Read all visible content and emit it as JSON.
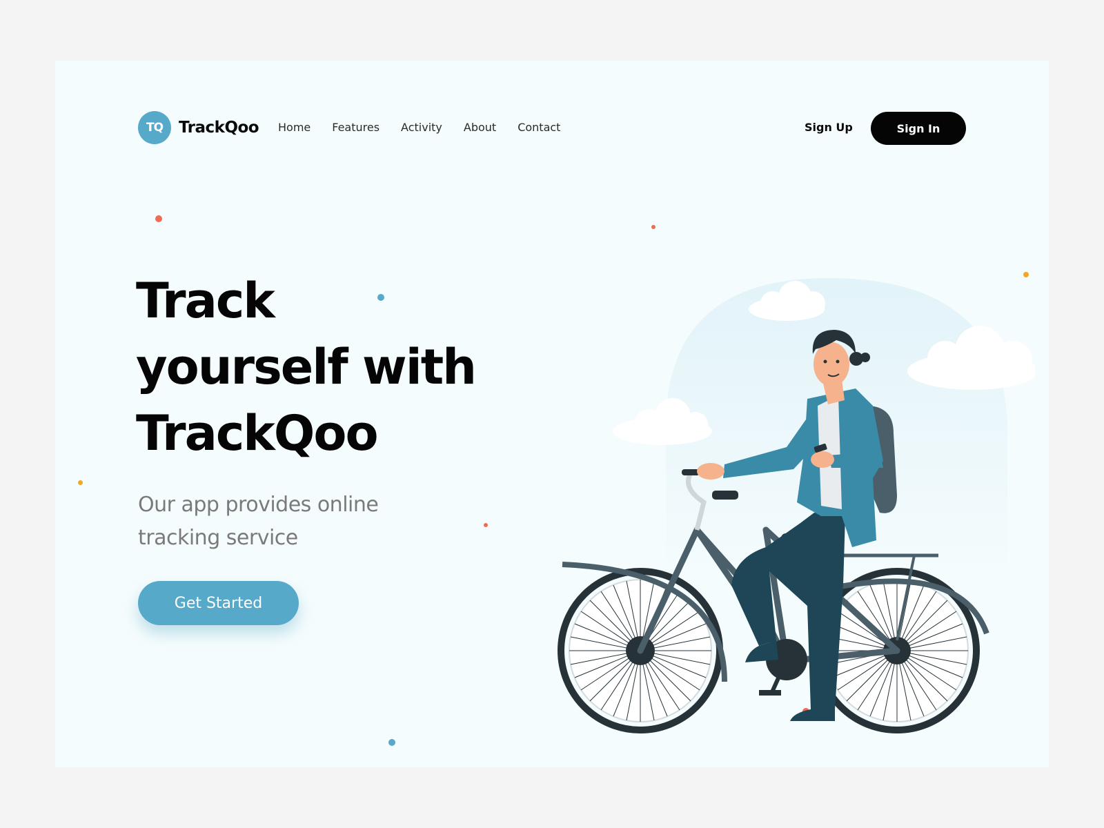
{
  "brand": {
    "logo_mark": "TQ",
    "name": "TrackQoo"
  },
  "nav": {
    "items": [
      "Home",
      "Features",
      "Activity",
      "About",
      "Contact"
    ]
  },
  "auth": {
    "signup_label": "Sign Up",
    "signin_label": "Sign In"
  },
  "hero": {
    "headline_lines": [
      "Track",
      "yourself with",
      "TrackQoo"
    ],
    "subtitle_lines": [
      "Our app provides online",
      "tracking service"
    ],
    "cta_label": "Get Started"
  },
  "illustration": {
    "subject": "man-riding-bicycle-illustration"
  },
  "colors": {
    "accent": "#57a9c9",
    "page_bg": "#f5fcfd",
    "outer_bg": "#f4f4f4",
    "dark": "#050505",
    "dot_coral": "#f06a55",
    "dot_orange": "#f5a623",
    "dot_blue": "#57a9c9"
  }
}
